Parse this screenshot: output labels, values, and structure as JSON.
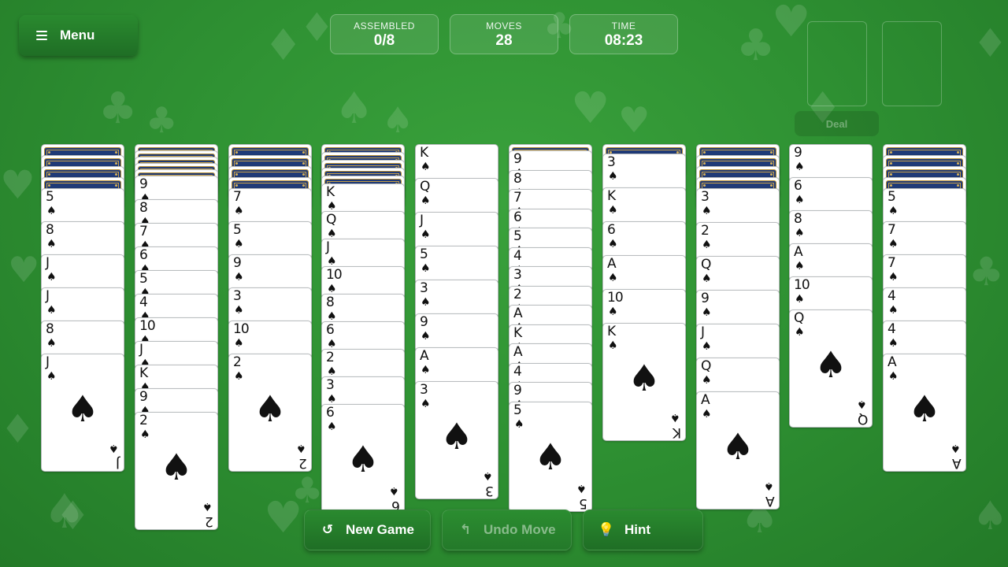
{
  "menu": {
    "label": "Menu",
    "icon": "hamburger-icon"
  },
  "stats": {
    "assembled": {
      "label": "ASSEMBLED",
      "value": "0/8"
    },
    "moves": {
      "label": "MOVES",
      "value": "28"
    },
    "time": {
      "label": "TIME",
      "value": "08:23"
    }
  },
  "deal": {
    "label": "Deal"
  },
  "suit_glyph": "♠",
  "columns": [
    {
      "hidden": 4,
      "cards": [
        "5",
        "8",
        "J",
        "J",
        "8",
        "J"
      ]
    },
    {
      "hidden": 5,
      "cards": [
        "9",
        "8",
        "7",
        "6",
        "5",
        "4",
        "10",
        "J",
        "K",
        "9",
        "2"
      ]
    },
    {
      "hidden": 4,
      "cards": [
        "7",
        "5",
        "9",
        "3",
        "10",
        "2"
      ]
    },
    {
      "hidden": 5,
      "cards": [
        "K",
        "Q",
        "J",
        "10",
        "8",
        "6",
        "2",
        "3",
        "6"
      ]
    },
    {
      "hidden": 0,
      "cards": [
        "K",
        "Q",
        "J",
        "5",
        "3",
        "9",
        "A",
        "3"
      ]
    },
    {
      "hidden": 1,
      "cards": [
        "9",
        "8",
        "7",
        "6",
        "5",
        "4",
        "3",
        "2",
        "A",
        "K",
        "A",
        "4",
        "9",
        "5"
      ]
    },
    {
      "hidden": 1,
      "cards": [
        "3",
        "K",
        "6",
        "A",
        "10",
        "K"
      ]
    },
    {
      "hidden": 4,
      "cards": [
        "3",
        "2",
        "Q",
        "9",
        "J",
        "Q",
        "A"
      ]
    },
    {
      "hidden": 0,
      "cards": [
        "9",
        "6",
        "8",
        "A",
        "10",
        "Q"
      ]
    },
    {
      "hidden": 4,
      "cards": [
        "5",
        "7",
        "7",
        "4",
        "4",
        "A"
      ]
    }
  ],
  "buttons": {
    "new_game": {
      "label": "New Game",
      "icon": "refresh-icon"
    },
    "undo": {
      "label": "Undo Move",
      "icon": "undo-icon"
    },
    "hint": {
      "label": "Hint",
      "icon": "lightbulb-icon"
    }
  },
  "colors": {
    "felt": "#2f9233",
    "card_back": "#1f3a77",
    "button": "#237a28"
  }
}
